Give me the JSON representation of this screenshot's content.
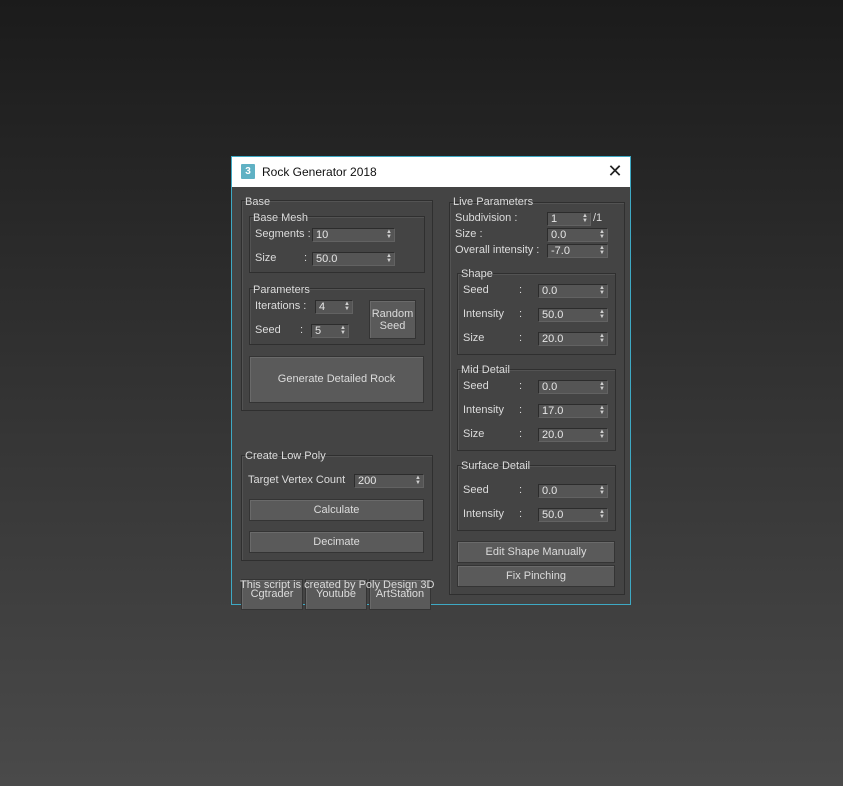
{
  "window": {
    "title": "Rock Generator 2018",
    "app_icon": "3",
    "close_glyph": "✕"
  },
  "base": {
    "label": "Base",
    "base_mesh": {
      "label": "Base Mesh",
      "segments_label": "Segments :",
      "segments_value": "10",
      "size_label": "Size",
      "size_colon": ":",
      "size_value": "50.0"
    },
    "parameters": {
      "label": "Parameters",
      "iterations_label": "Iterations :",
      "iterations_value": "4",
      "seed_label": "Seed",
      "seed_colon": ":",
      "seed_value": "5",
      "random_seed_line1": "Random",
      "random_seed_line2": "Seed"
    },
    "generate_button": "Generate Detailed Rock"
  },
  "low_poly": {
    "label": "Create Low Poly",
    "target_label": "Target Vertex Count",
    "target_value": "200",
    "calculate_button": "Calculate",
    "decimate_button": "Decimate"
  },
  "links": {
    "cgtrader": "Cgtrader",
    "youtube": "Youtube",
    "artstation": "ArtStation"
  },
  "credit": "This script is created by Poly Design 3D",
  "live": {
    "label": "Live Parameters",
    "subdivision_label": "Subdivision :",
    "subdivision_value": "1",
    "subdivision_max": "/1",
    "size_label": "Size :",
    "size_value": "0.0",
    "overall_label": "Overall intensity :",
    "overall_value": "-7.0",
    "shape": {
      "label": "Shape",
      "seed_label": "Seed",
      "seed_value": "0.0",
      "intensity_label": "Intensity",
      "intensity_value": "50.0",
      "size_label": "Size",
      "size_value": "20.0"
    },
    "mid": {
      "label": "Mid Detail",
      "seed_label": "Seed",
      "seed_value": "0.0",
      "intensity_label": "Intensity",
      "intensity_value": "17.0",
      "size_label": "Size",
      "size_value": "20.0"
    },
    "surface": {
      "label": "Surface Detail",
      "seed_label": "Seed",
      "seed_value": "0.0",
      "intensity_label": "Intensity",
      "intensity_value": "50.0"
    },
    "colon": ":",
    "edit_shape_button": "Edit Shape Manually",
    "fix_pinching_button": "Fix Pinching"
  },
  "icons": {
    "spinner_arrows": "spinner-arrows-icon",
    "close": "close-icon"
  },
  "colors": {
    "window_border": "#3ea9c4",
    "panel": "#444444",
    "field": "#555555",
    "button": "#5a5a5a"
  }
}
